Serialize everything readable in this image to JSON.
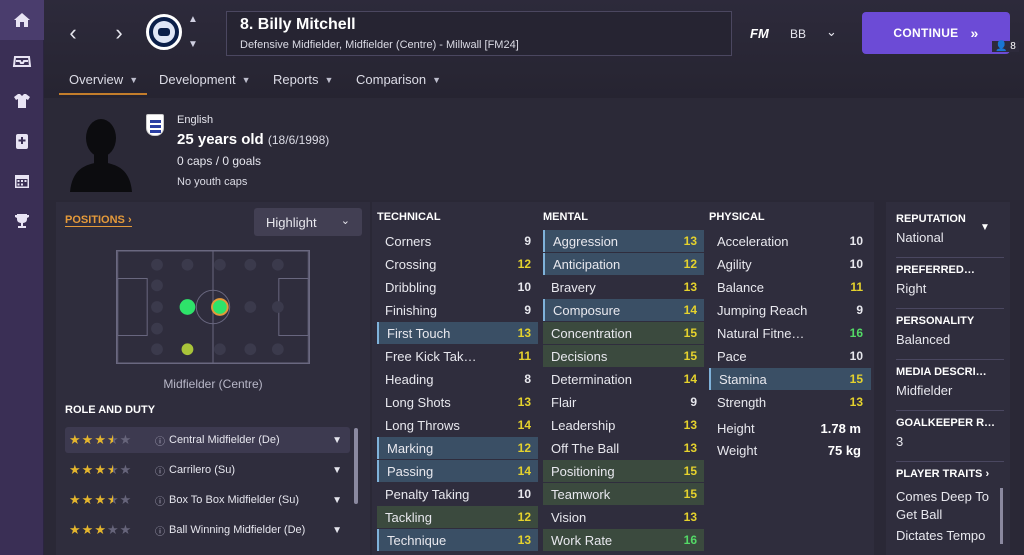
{
  "sidebar": {
    "icons": [
      "home-icon",
      "inbox-icon",
      "squad-icon",
      "medical-icon",
      "calendar-icon",
      "trophy-icon"
    ]
  },
  "header": {
    "player_name": "8. Billy Mitchell",
    "subtitle": "Defensive Midfielder, Midfielder (Centre) - Millwall [FM24]",
    "fm_label": "FM",
    "manager_initials": "BB",
    "continue_label": "CONTINUE",
    "continue_arrows": "»",
    "notification_count": "8"
  },
  "tabs": [
    {
      "label": "Overview"
    },
    {
      "label": "Development"
    },
    {
      "label": "Reports"
    },
    {
      "label": "Comparison"
    }
  ],
  "profile": {
    "nationality": "English",
    "age": "25 years old",
    "dob": "(18/6/1998)",
    "caps": "0 caps / 0 goals",
    "youth": "No youth caps"
  },
  "positions": {
    "title": "POSITIONS",
    "highlight_label": "Highlight",
    "position_label": "Midfielder (Centre)",
    "role_title": "ROLE AND DUTY",
    "roles": [
      {
        "name": "Central Midfielder (De)",
        "stars": 3.5
      },
      {
        "name": "Carrilero (Su)",
        "stars": 3.5
      },
      {
        "name": "Box To Box Midfielder (Su)",
        "stars": 3.5
      },
      {
        "name": "Ball Winning Midfielder (De)",
        "stars": 3
      }
    ]
  },
  "technical": {
    "title": "TECHNICAL",
    "attrs": [
      {
        "name": "Corners",
        "value": "9"
      },
      {
        "name": "Crossing",
        "value": "12"
      },
      {
        "name": "Dribbling",
        "value": "10"
      },
      {
        "name": "Finishing",
        "value": "9"
      },
      {
        "name": "First Touch",
        "value": "13"
      },
      {
        "name": "Free Kick Tak…",
        "value": "11"
      },
      {
        "name": "Heading",
        "value": "8"
      },
      {
        "name": "Long Shots",
        "value": "13"
      },
      {
        "name": "Long Throws",
        "value": "14"
      },
      {
        "name": "Marking",
        "value": "12"
      },
      {
        "name": "Passing",
        "value": "14"
      },
      {
        "name": "Penalty Taking",
        "value": "10"
      },
      {
        "name": "Tackling",
        "value": "12"
      },
      {
        "name": "Technique",
        "value": "13"
      }
    ]
  },
  "mental": {
    "title": "MENTAL",
    "attrs": [
      {
        "name": "Aggression",
        "value": "13"
      },
      {
        "name": "Anticipation",
        "value": "12"
      },
      {
        "name": "Bravery",
        "value": "13"
      },
      {
        "name": "Composure",
        "value": "14"
      },
      {
        "name": "Concentration",
        "value": "15"
      },
      {
        "name": "Decisions",
        "value": "15"
      },
      {
        "name": "Determination",
        "value": "14"
      },
      {
        "name": "Flair",
        "value": "9"
      },
      {
        "name": "Leadership",
        "value": "13"
      },
      {
        "name": "Off The Ball",
        "value": "13"
      },
      {
        "name": "Positioning",
        "value": "15"
      },
      {
        "name": "Teamwork",
        "value": "15"
      },
      {
        "name": "Vision",
        "value": "13"
      },
      {
        "name": "Work Rate",
        "value": "16"
      }
    ]
  },
  "physical": {
    "title": "PHYSICAL",
    "attrs": [
      {
        "name": "Acceleration",
        "value": "10"
      },
      {
        "name": "Agility",
        "value": "10"
      },
      {
        "name": "Balance",
        "value": "11"
      },
      {
        "name": "Jumping Reach",
        "value": "9"
      },
      {
        "name": "Natural Fitne…",
        "value": "16"
      },
      {
        "name": "Pace",
        "value": "10"
      },
      {
        "name": "Stamina",
        "value": "15"
      },
      {
        "name": "Strength",
        "value": "13"
      }
    ],
    "height_label": "Height",
    "height": "1.78 m",
    "weight_label": "Weight",
    "weight": "75 kg"
  },
  "info": {
    "reputation_label": "REPUTATION",
    "reputation": "National",
    "foot_label": "PREFERRED…",
    "foot": "Right",
    "personality_label": "PERSONALITY",
    "personality": "Balanced",
    "media_label": "MEDIA DESCRI…",
    "media": "Midfielder",
    "gk_label": "GOALKEEPER R…",
    "gk": "3",
    "traits_label": "PLAYER TRAITS",
    "trait1": "Comes Deep To Get Ball",
    "trait2": "Dictates Tempo"
  }
}
